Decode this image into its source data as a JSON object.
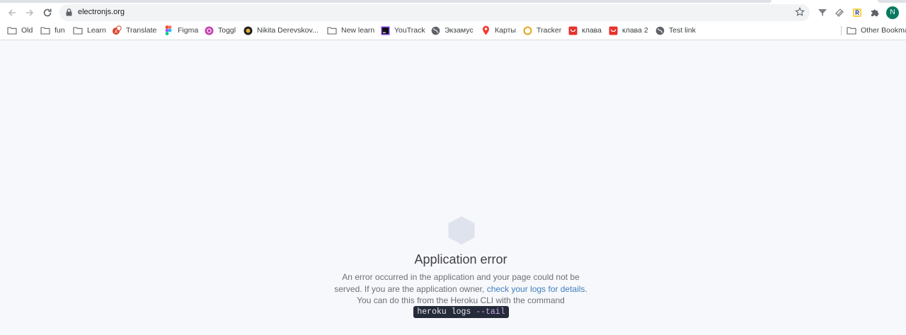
{
  "browser": {
    "url": "electronjs.org",
    "profile_initial": "N",
    "colors": {
      "profile_bg": "#0a7a5e",
      "omnibox_bg": "#f1f3f4"
    },
    "nav_icons": [
      "back-arrow-icon",
      "forward-arrow-icon",
      "reload-icon"
    ],
    "extension_icons": [
      "filter-funnel-icon",
      "layers-stack-icon",
      "r-badge-icon",
      "puzzle-piece-icon"
    ]
  },
  "bookmarks": {
    "items": [
      {
        "label": "Old",
        "icon": "folder-icon"
      },
      {
        "label": "fun",
        "icon": "folder-icon"
      },
      {
        "label": "Learn",
        "icon": "folder-icon"
      },
      {
        "label": "Translate",
        "icon": "translate-icon"
      },
      {
        "label": "Figma",
        "icon": "figma-icon"
      },
      {
        "label": "Toggl",
        "icon": "toggl-icon"
      },
      {
        "label": "Nikita Derevskov...",
        "icon": "avatar-icon"
      },
      {
        "label": "New learn",
        "icon": "folder-icon"
      },
      {
        "label": "YouTrack",
        "icon": "youtrack-icon"
      },
      {
        "label": "Экзамус",
        "icon": "globe-icon"
      },
      {
        "label": "Карты",
        "icon": "map-pin-icon"
      },
      {
        "label": "Tracker",
        "icon": "ring-icon"
      },
      {
        "label": "клава",
        "icon": "shop-bag-icon"
      },
      {
        "label": "клава 2",
        "icon": "shop-bag-icon"
      },
      {
        "label": "Test link",
        "icon": "globe-icon"
      }
    ],
    "other": "Other Bookmarks"
  },
  "error_page": {
    "title": "Application error",
    "line1": "An error occurred in the application and your page could not be",
    "line2_prefix": "served. If you are the application owner, ",
    "line2_link": "check your logs for details",
    "line2_suffix": ".",
    "line3": "You can do this from the Heroku CLI with the command",
    "command_main": "heroku logs ",
    "command_flag": "--tail",
    "colors": {
      "link": "#3f7fbf",
      "command_bg": "#262b3a",
      "hexagon": "#dfe3ee"
    }
  }
}
